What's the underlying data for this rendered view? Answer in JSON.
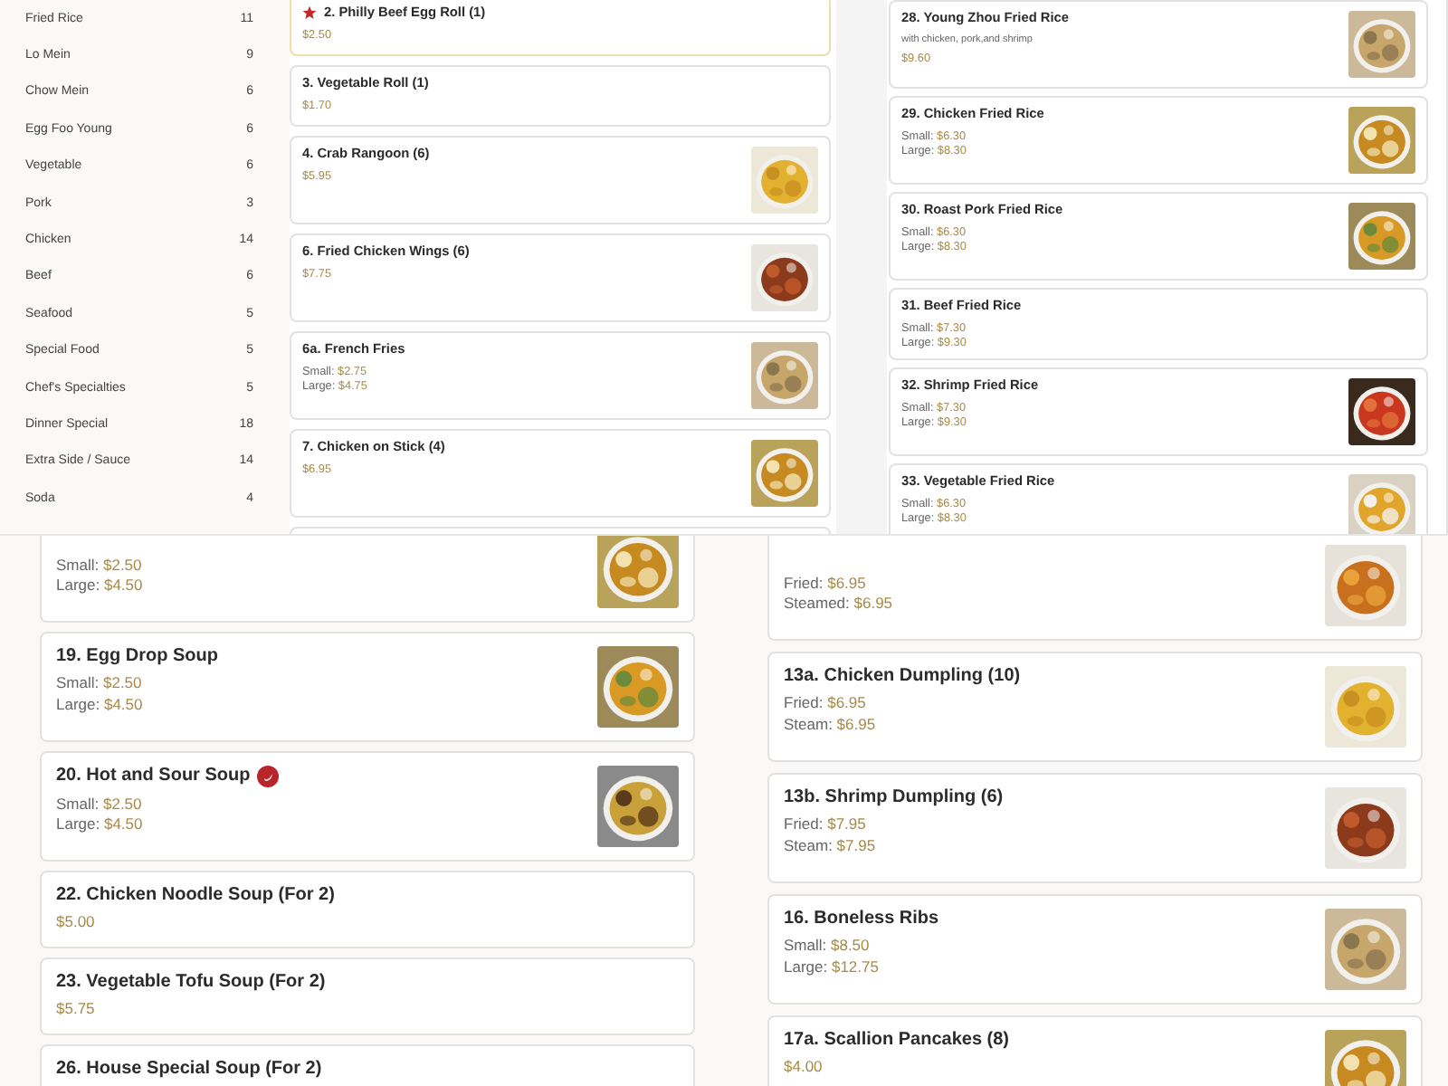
{
  "category_sidebar": {
    "items": [
      {
        "label": "Fried Rice",
        "count": "11"
      },
      {
        "label": "Lo Mein",
        "count": "9"
      },
      {
        "label": "Chow Mein",
        "count": "6"
      },
      {
        "label": "Egg Foo Young",
        "count": "6"
      },
      {
        "label": "Vegetable",
        "count": "6"
      },
      {
        "label": "Pork",
        "count": "3"
      },
      {
        "label": "Chicken",
        "count": "14"
      },
      {
        "label": "Beef",
        "count": "6"
      },
      {
        "label": "Seafood",
        "count": "5"
      },
      {
        "label": "Special Food",
        "count": "5"
      },
      {
        "label": "Chef's Specialties",
        "count": "5"
      },
      {
        "label": "Dinner Special",
        "count": "18"
      },
      {
        "label": "Extra Side / Sauce",
        "count": "14"
      },
      {
        "label": "Soda",
        "count": "4"
      }
    ]
  },
  "top_menu_list": {
    "items": [
      {
        "title": "2. Philly Beef Egg Roll (1)",
        "starred": true,
        "highlighted": true,
        "photo": false,
        "prices": [
          {
            "amount": "$2.50"
          }
        ]
      },
      {
        "title": "3. Vegetable Roll (1)",
        "starred": false,
        "highlighted": false,
        "photo": false,
        "prices": [
          {
            "amount": "$1.70"
          }
        ]
      },
      {
        "title": "4. Crab Rangoon (6)",
        "starred": false,
        "highlighted": false,
        "photo": true,
        "prices": [
          {
            "amount": "$5.95"
          }
        ]
      },
      {
        "title": "6. Fried Chicken Wings (6)",
        "starred": false,
        "highlighted": false,
        "photo": true,
        "prices": [
          {
            "amount": "$7.75"
          }
        ]
      },
      {
        "title": "6a. French Fries",
        "starred": false,
        "highlighted": false,
        "photo": true,
        "prices": [
          {
            "label": "Small:",
            "amount": "$2.75"
          },
          {
            "label": "Large:",
            "amount": "$4.75"
          }
        ]
      },
      {
        "title": "7. Chicken on Stick (4)",
        "starred": false,
        "highlighted": false,
        "photo": true,
        "prices": [
          {
            "amount": "$6.95"
          }
        ]
      }
    ]
  },
  "fried_rice_list": {
    "items": [
      {
        "title": "28. Young Zhou Fried Rice",
        "description": "with chicken, pork,and shrimp",
        "photo": true,
        "prices": [
          {
            "amount": "$9.60"
          }
        ]
      },
      {
        "title": "29. Chicken Fried Rice",
        "photo": true,
        "prices": [
          {
            "label": "Small:",
            "amount": "$6.30"
          },
          {
            "label": "Large:",
            "amount": "$8.30"
          }
        ]
      },
      {
        "title": "30. Roast Pork Fried Rice",
        "photo": true,
        "prices": [
          {
            "label": "Small:",
            "amount": "$6.30"
          },
          {
            "label": "Large:",
            "amount": "$8.30"
          }
        ]
      },
      {
        "title": "31. Beef Fried Rice",
        "photo": false,
        "prices": [
          {
            "label": "Small:",
            "amount": "$7.30"
          },
          {
            "label": "Large:",
            "amount": "$9.30"
          }
        ]
      },
      {
        "title": "32. Shrimp Fried Rice",
        "photo": true,
        "prices": [
          {
            "label": "Small:",
            "amount": "$7.30"
          },
          {
            "label": "Large:",
            "amount": "$9.30"
          }
        ]
      },
      {
        "title": "33. Vegetable Fried Rice",
        "photo": true,
        "prices": [
          {
            "label": "Small:",
            "amount": "$6.30"
          },
          {
            "label": "Large:",
            "amount": "$8.30"
          }
        ]
      }
    ]
  },
  "soup_list": {
    "items": [
      {
        "spicy": false,
        "photo": true,
        "prices": [
          {
            "label": "Small:",
            "amount": "$2.50"
          },
          {
            "label": "Large:",
            "amount": "$4.50"
          }
        ]
      },
      {
        "title": "19. Egg Drop Soup",
        "spicy": false,
        "photo": true,
        "prices": [
          {
            "label": "Small:",
            "amount": "$2.50"
          },
          {
            "label": "Large:",
            "amount": "$4.50"
          }
        ]
      },
      {
        "title": "20. Hot and Sour Soup",
        "spicy": true,
        "photo": true,
        "prices": [
          {
            "label": "Small:",
            "amount": "$2.50"
          },
          {
            "label": "Large:",
            "amount": "$4.50"
          }
        ]
      },
      {
        "title": "22. Chicken Noodle Soup (For 2)",
        "spicy": false,
        "photo": false,
        "prices": [
          {
            "amount": "$5.00"
          }
        ]
      },
      {
        "title": "23. Vegetable Tofu Soup (For 2)",
        "spicy": false,
        "photo": false,
        "prices": [
          {
            "amount": "$5.75"
          }
        ]
      },
      {
        "title": "26. House Special Soup (For 2)",
        "spicy": false,
        "photo": false
      }
    ]
  },
  "appetizer_list": {
    "items": [
      {
        "photo": true,
        "prices": [
          {
            "label": "Fried:",
            "amount": "$6.95"
          },
          {
            "label": "Steamed:",
            "amount": "$6.95"
          }
        ]
      },
      {
        "title": "13a. Chicken Dumpling (10)",
        "photo": true,
        "prices": [
          {
            "label": "Fried:",
            "amount": "$6.95"
          },
          {
            "label": "Steam:",
            "amount": "$6.95"
          }
        ]
      },
      {
        "title": "13b. Shrimp Dumpling (6)",
        "photo": true,
        "prices": [
          {
            "label": "Fried:",
            "amount": "$7.95"
          },
          {
            "label": "Steam:",
            "amount": "$7.95"
          }
        ]
      },
      {
        "title": "16. Boneless Ribs",
        "photo": true,
        "prices": [
          {
            "label": "Small:",
            "amount": "$8.50"
          },
          {
            "label": "Large:",
            "amount": "$12.75"
          }
        ]
      },
      {
        "title": "17a. Scallion Pancakes (8)",
        "photo": true,
        "prices": [
          {
            "amount": "$4.00"
          }
        ]
      }
    ]
  }
}
